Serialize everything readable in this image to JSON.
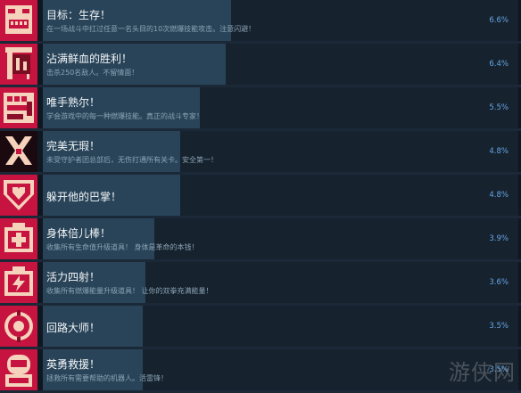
{
  "achievements": [
    {
      "title": "目标：生存！",
      "description": "在一场战斗中扛过任意一名头目的10次燃爆技能攻击。注意闪避！",
      "percent": "6.6%",
      "icon": "grinning-face-icon",
      "progress": 0.066
    },
    {
      "title": "沾满鲜血的胜利！",
      "description": "击杀250名敌人。不留情面！",
      "percent": "6.4%",
      "icon": "bloody-banner-icon",
      "progress": 0.064
    },
    {
      "title": "唯手熟尔！",
      "description": "学会游戏中的每一种燃爆技能。真正的战斗专家！",
      "percent": "5.5%",
      "icon": "power-fist-icon",
      "progress": 0.055
    },
    {
      "title": "完美无瑕！",
      "description": "未受守护者团总部后，无伤打通所有关卡。安全第一！",
      "percent": "4.8%",
      "icon": "crossed-lightning-icon",
      "progress": 0.048
    },
    {
      "title": "躲开他的巴掌！",
      "description": "",
      "percent": "4.8%",
      "icon": "shield-heart-icon",
      "progress": 0.048
    },
    {
      "title": "身体倍儿棒！",
      "description": "收集所有生命值升级道具！ 身体是革命的本钱！",
      "percent": "3.9%",
      "icon": "health-pack-icon",
      "progress": 0.039
    },
    {
      "title": "活力四射！",
      "description": "收集所有燃爆能量升级道具！ 让你的双拳充满能量！",
      "percent": "3.6%",
      "icon": "energy-pack-icon",
      "progress": 0.036
    },
    {
      "title": "回路大师！",
      "description": "",
      "percent": "3.5%",
      "icon": "circuit-medal-icon",
      "progress": 0.035
    },
    {
      "title": "英勇救援！",
      "description": "拯救所有需要帮助的机器人。活雷锋！",
      "percent": "3.5%",
      "icon": "robot-helmet-icon",
      "progress": 0.035
    }
  ],
  "watermark": "游侠网",
  "colors": {
    "background": "#1b2838",
    "icon_red": "#c6133f",
    "icon_pale": "#f5d2bb",
    "title": "#f2f5f7",
    "description": "#8ba3b5",
    "percent": "#66a6e8",
    "progress_fill": "#294459"
  }
}
